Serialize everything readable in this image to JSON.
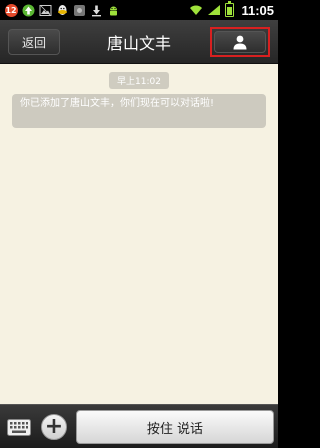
{
  "status_bar": {
    "notification_count": "12",
    "time": "11:05",
    "left_icons": [
      "notification-count-icon",
      "upload-arrow-icon",
      "image-icon",
      "qq-icon",
      "unknown-app-icon",
      "download-icon",
      "android-icon"
    ],
    "right_icons": [
      "wifi-icon",
      "signal-icon",
      "battery-icon"
    ],
    "battery_level": 0.7
  },
  "title_bar": {
    "back_label": "返回",
    "title": "唐山文丰",
    "profile_icon": "person-icon",
    "highlight_color": "#d82020"
  },
  "chat": {
    "timestamp": "早上11:02",
    "system_message": "你已添加了唐山文丰，你们现在可以对话啦!"
  },
  "bottom_bar": {
    "keyboard_icon": "keyboard-icon",
    "plus_icon": "plus-icon",
    "plus_glyph": "+",
    "hold_to_talk_label": "按住 说话"
  },
  "colors": {
    "chat_background": "#f6f2e2",
    "bubble_background": "#cdcabf",
    "titlebar_background": "#2e2e2e"
  }
}
